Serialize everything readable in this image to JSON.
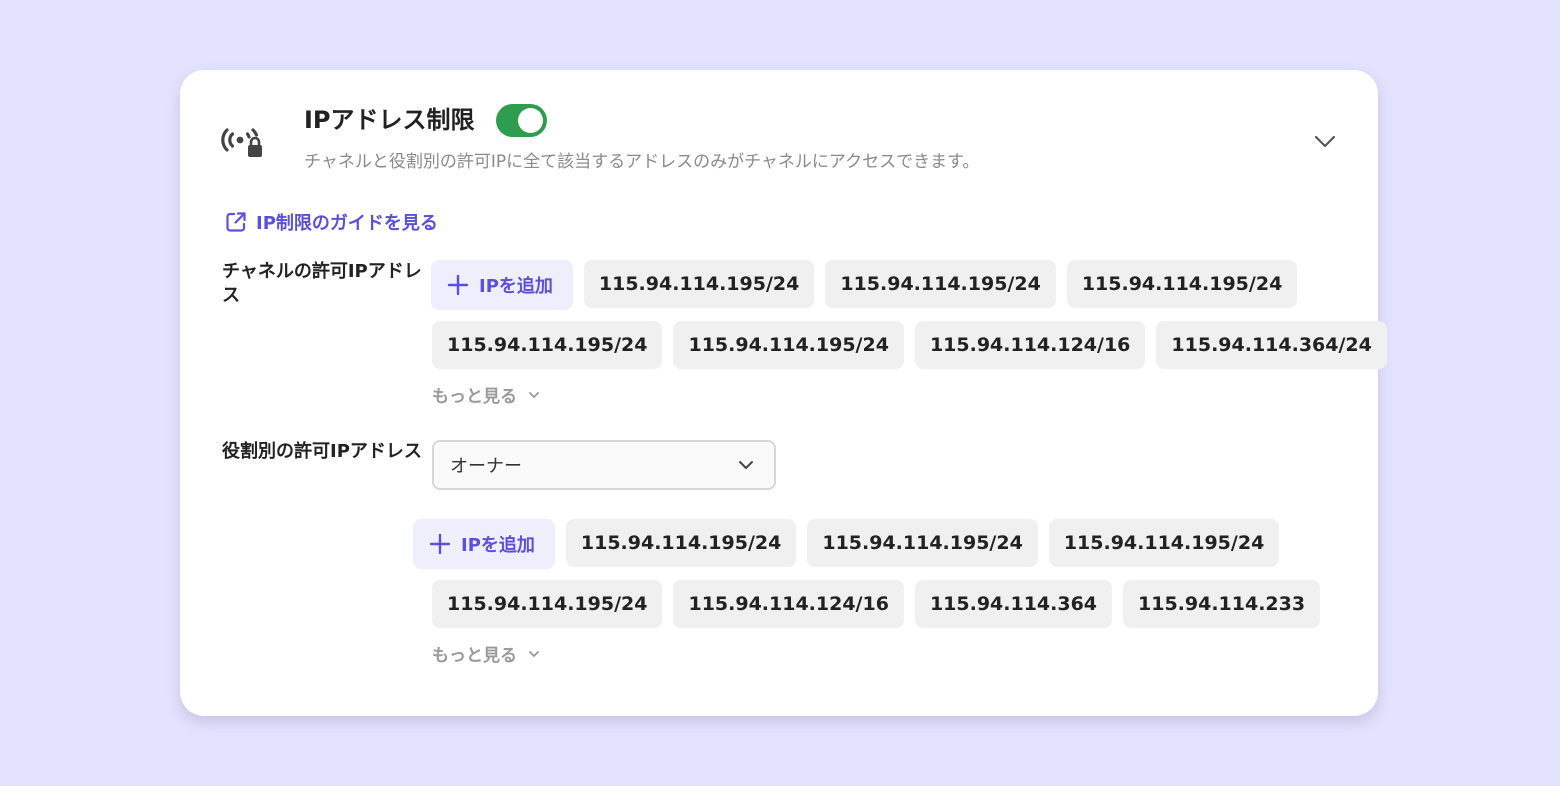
{
  "header": {
    "title": "IPアドレス制限",
    "toggle_on": true,
    "subtitle": "チャネルと役割別の許可IPに全て該当するアドレスのみがチャネルにアクセスできます。"
  },
  "icons": {
    "header": "wireless-lock-icon",
    "collapse": "chevron-down-icon",
    "guide": "external-link-icon",
    "add": "plus-icon"
  },
  "colors": {
    "background": "#e3e3fe",
    "accent": "#5b50d8",
    "toggle_on": "#2e9e4e"
  },
  "guide_link": {
    "label": "IP制限のガイドを見る"
  },
  "channel_section": {
    "label": "チャネルの許可IPアドレス",
    "add_label": "IPを追加",
    "row1": [
      "115.94.114.195/24",
      "115.94.114.195/24",
      "115.94.114.195/24"
    ],
    "row2": [
      "115.94.114.195/24",
      "115.94.114.195/24",
      "115.94.114.124/16",
      "115.94.114.364/24"
    ],
    "more_label": "もっと見る"
  },
  "role_section": {
    "label": "役割別の許可IPアドレス",
    "selected_role": "オーナー",
    "add_label": "IPを追加",
    "row1": [
      "115.94.114.195/24",
      "115.94.114.195/24",
      "115.94.114.195/24"
    ],
    "row2": [
      "115.94.114.195/24",
      "115.94.114.124/16",
      "115.94.114.364",
      "115.94.114.233"
    ],
    "more_label": "もっと見る"
  }
}
